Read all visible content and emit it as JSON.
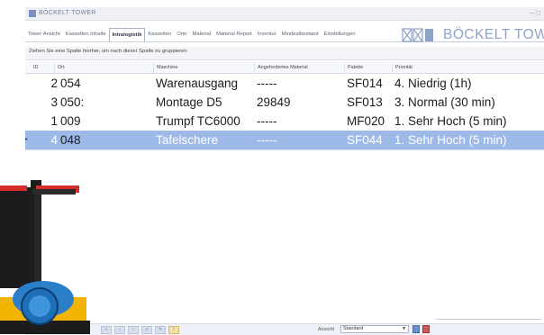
{
  "window": {
    "title": "BÖCKELT TOWER",
    "controls": "– □"
  },
  "tabs": [
    {
      "label": "Tower Ansicht",
      "active": false
    },
    {
      "label": "Kassetten Inhalte",
      "active": false
    },
    {
      "label": "Intralogistik",
      "active": true
    },
    {
      "label": "Kassetten",
      "active": false
    },
    {
      "label": "Orte",
      "active": false
    },
    {
      "label": "Material",
      "active": false
    },
    {
      "label": "Material Report",
      "active": false
    },
    {
      "label": "Inventur",
      "active": false
    },
    {
      "label": "Mindestbestand",
      "active": false
    },
    {
      "label": "Einstellungen",
      "active": false
    }
  ],
  "logo": {
    "text": "BÖCKELT TOWER",
    "color": "#8ea3c8"
  },
  "groupbar": {
    "text": "Ziehen Sie eine Spalte hierher, um nach dieser Spalte zu gruppieren"
  },
  "table": {
    "columns": [
      "ID",
      "Ort",
      "Maschine",
      "Angefordertes Material",
      "Palette",
      "Priorität"
    ],
    "rows": [
      {
        "id": "2",
        "ort": "054",
        "maschine": "Warenausgang",
        "material": "-----",
        "palette": "SF014",
        "prioritaet": "4. Niedrig (1h)",
        "selected": false
      },
      {
        "id": "3",
        "ort": "050:",
        "maschine": "Montage D5",
        "material": "29849",
        "palette": "SF013",
        "prioritaet": "3. Normal (30 min)",
        "selected": false
      },
      {
        "id": "1",
        "ort": "009",
        "maschine": "Trumpf TC6000",
        "material": "-----",
        "palette": "MF020",
        "prioritaet": "1. Sehr Hoch (5 min)",
        "selected": false
      },
      {
        "id": "4",
        "ort": "048",
        "maschine": "Tafelschere",
        "material": "-----",
        "palette": "SF044",
        "prioritaet": "1. Sehr Hoch (5 min)",
        "selected": true
      }
    ],
    "selected_color": "#9db9e8"
  },
  "bottombar": {
    "ansicht_label": "Ansicht",
    "ansicht_value": "Standard"
  }
}
